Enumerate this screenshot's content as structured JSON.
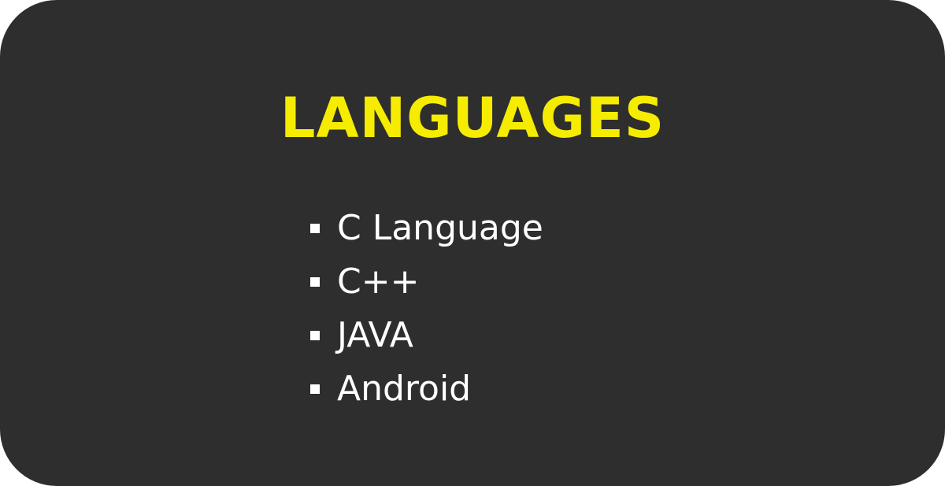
{
  "card": {
    "title": "LANGUAGES",
    "title_color": "#f5ec00",
    "background_color": "#2e2e2e",
    "items": [
      {
        "label": "C Language",
        "icon": "square-bullet-icon"
      },
      {
        "label": "C++",
        "icon": "square-bullet-icon"
      },
      {
        "label": "JAVA",
        "icon": "square-bullet-icon"
      },
      {
        "label": "Android",
        "icon": "square-bullet-icon"
      }
    ]
  }
}
